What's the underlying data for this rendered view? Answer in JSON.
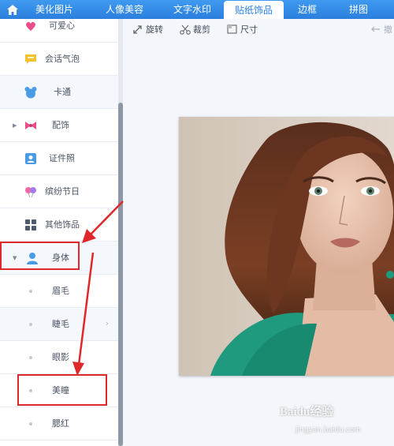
{
  "tabs": [
    {
      "label": "美化图片"
    },
    {
      "label": "人像美容"
    },
    {
      "label": "文字水印"
    },
    {
      "label": "贴纸饰品",
      "active": true
    },
    {
      "label": "边框"
    },
    {
      "label": "拼图"
    }
  ],
  "sidebar": {
    "categories": [
      {
        "label": "可爱心",
        "icon": "heart-icon"
      },
      {
        "label": "会话气泡",
        "icon": "speech-bubble-icon"
      },
      {
        "label": "卡通",
        "icon": "cartoon-bear-icon"
      },
      {
        "label": "配饰",
        "icon": "bow-icon"
      },
      {
        "label": "证件照",
        "icon": "id-photo-icon"
      },
      {
        "label": "缤纷节日",
        "icon": "balloons-icon"
      },
      {
        "label": "其他饰品",
        "icon": "grid-icon"
      },
      {
        "label": "身体",
        "icon": "person-icon",
        "expanded": true
      }
    ],
    "subitems": [
      {
        "label": "眉毛"
      },
      {
        "label": "睫毛"
      },
      {
        "label": "眼影"
      },
      {
        "label": "美瞳"
      },
      {
        "label": "腮红"
      }
    ]
  },
  "toolbar": {
    "rotate_label": "旋转",
    "crop_label": "裁剪",
    "size_label": "尺寸",
    "undo_label": "撤"
  },
  "watermark": {
    "brand": "Baidu经验",
    "url": "jingyan.baidu.com"
  },
  "colors": {
    "tab_bar": "#2b7fde",
    "accent": "#3f9af0",
    "highlight": "#e0282b"
  }
}
